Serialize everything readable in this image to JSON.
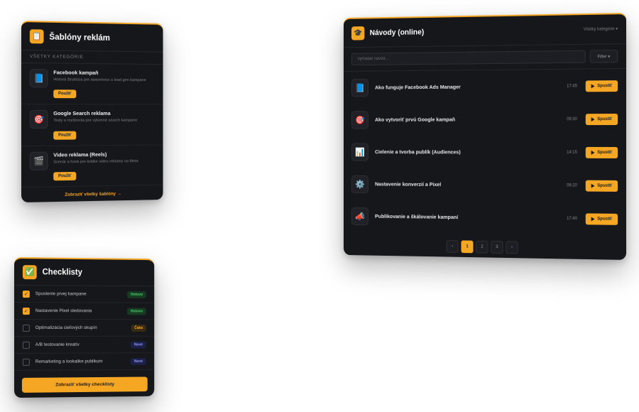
{
  "templates": {
    "header_icon": "clipboard-icon",
    "title": "Šablóny reklám",
    "category_label": "VŠETKY KATEGÓRIE",
    "items": [
      {
        "icon": "📘",
        "icon_name": "facebook-book-icon",
        "title": "Facebook kampaň",
        "desc": "Hotová štruktúra pre awareness a lead gen kampane",
        "button": "Použiť"
      },
      {
        "icon": "🎯",
        "icon_name": "target-icon",
        "title": "Google Search reklama",
        "desc": "Texty a rozšírenia pre výkonné search kampane",
        "button": "Použiť"
      },
      {
        "icon": "🎬",
        "icon_name": "clapperboard-icon",
        "title": "Video reklama (Reels)",
        "desc": "Scenár a hook pre krátke video reklamy na Meta",
        "button": "Použiť"
      }
    ],
    "footer_link": "Zobraziť všetky šablóny →"
  },
  "checklists": {
    "header_icon": "check-mark-icon",
    "title": "Checklisty",
    "items": [
      {
        "label": "Spustenie prvej kampane",
        "checked": true,
        "badge": "Hotovo",
        "status": "done"
      },
      {
        "label": "Nastavenie Pixel sledovania",
        "checked": true,
        "badge": "Hotovo",
        "status": "done"
      },
      {
        "label": "Optimalizácia cieľových skupín",
        "checked": false,
        "badge": "Čaká",
        "status": "wait"
      },
      {
        "label": "A/B testovanie kreatív",
        "checked": false,
        "badge": "Nové",
        "status": "new"
      },
      {
        "label": "Remarketing a lookalike publikum",
        "checked": false,
        "badge": "Nové",
        "status": "new"
      }
    ],
    "button": "Zobraziť všetky checklisty"
  },
  "guides": {
    "header_icon": "graduation-cap-icon",
    "title": "Návody (online)",
    "category_select": "Všetky kategórie ▾",
    "search_placeholder": "Vyhľadať návod...",
    "filter_label": "Filter ▾",
    "items": [
      {
        "icon": "📘",
        "icon_name": "facebook-book-icon",
        "title": "Ako funguje Facebook Ads Manager",
        "duration": "17:45",
        "button": "Spustiť"
      },
      {
        "icon": "🎯",
        "icon_name": "target-icon",
        "title": "Ako vytvoriť prvú Google kampaň",
        "duration": "09:30",
        "button": "Spustiť"
      },
      {
        "icon": "📊",
        "icon_name": "bar-chart-icon",
        "title": "Cielenie a tvorba publík (Audiences)",
        "duration": "14:15",
        "button": "Spustiť"
      },
      {
        "icon": "⚙️",
        "icon_name": "gear-icon",
        "title": "Nastavenie konverzií a Pixel",
        "duration": "09:20",
        "button": "Spustiť"
      },
      {
        "icon": "📣",
        "icon_name": "megaphone-icon",
        "title": "Publikovanie a škálovanie kampaní",
        "duration": "17:40",
        "button": "Spustiť"
      }
    ],
    "pagination": {
      "prev": "‹",
      "pages": [
        "1",
        "2",
        "3"
      ],
      "active": "1",
      "next": "›"
    }
  },
  "colors": {
    "accent": "#f5a623",
    "card_bg": "#16171b",
    "done": "#4ccf6d",
    "new": "#8f97ff"
  }
}
